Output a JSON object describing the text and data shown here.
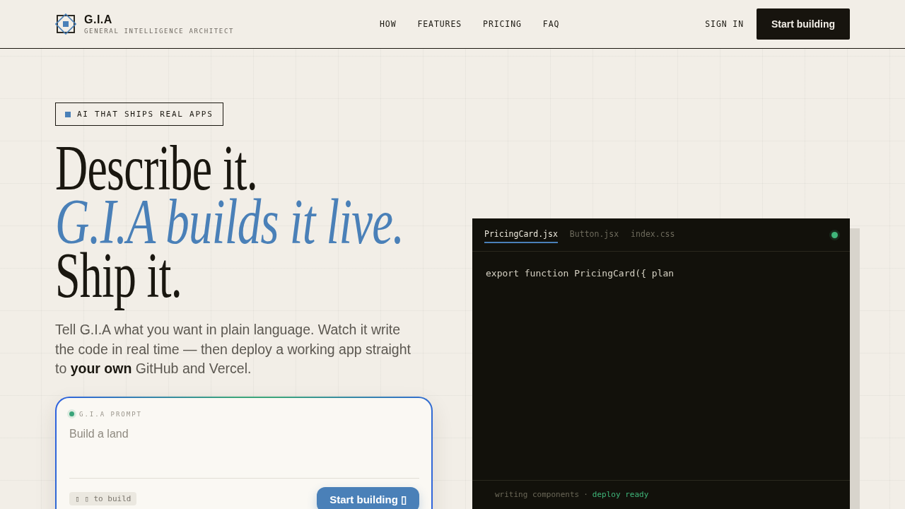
{
  "header": {
    "logo": {
      "name": "G.I.A",
      "tagline": "GENERAL INTELLIGENCE ARCHITECT"
    },
    "nav": [
      "HOW",
      "FEATURES",
      "PRICING",
      "FAQ"
    ],
    "sign_in": "SIGN IN",
    "cta": "Start building"
  },
  "hero": {
    "badge": "AI THAT SHIPS REAL APPS",
    "headline": [
      {
        "text": "Describe it.",
        "kind": "plain"
      },
      {
        "text": "G.I.A builds it live.",
        "kind": "accent"
      },
      {
        "text": "Ship it.",
        "kind": "plain"
      }
    ],
    "description": "Tell G.I.A what you want in plain language. Watch it write the code in real time — then deploy a working app straight to **your own** GitHub and Vercel.",
    "prompt": {
      "label": "G.I.A PROMPT",
      "placeholder": "Build a land",
      "shortcut": "▯ ▯ to build",
      "button": "Start building ▯"
    }
  },
  "editor": {
    "tabs": [
      {
        "label": "PricingCard.jsx",
        "selected": true
      },
      {
        "label": "Button.jsx",
        "selected": false
      },
      {
        "label": "index.css",
        "selected": false
      }
    ],
    "code": [
      "export function PricingCard({ plan"
    ],
    "status_bar": {
      "items": [
        {
          "text": "writing components",
          "color": "#6b6858"
        },
        {
          "text": "deploy ready",
          "color": "#3fb67a"
        }
      ],
      "separator": "·"
    }
  }
}
